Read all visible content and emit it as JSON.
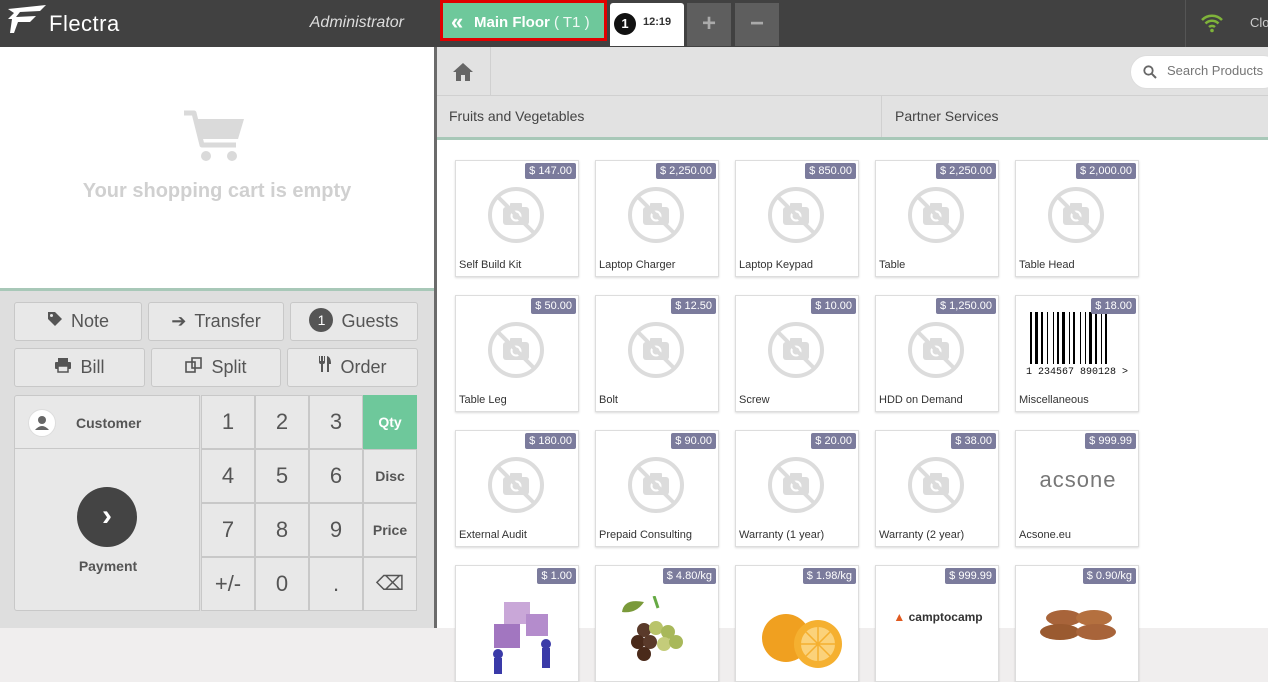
{
  "header": {
    "brand": "Flectra",
    "user": "Administrator",
    "floor_label": "Main Floor",
    "table_label": "( T1 )",
    "order_number": "1",
    "order_time": "12:19",
    "add_order": "+",
    "remove_order": "−",
    "close_label": "Clo"
  },
  "cart": {
    "empty_text": "Your shopping cart is empty"
  },
  "controls": {
    "note": "Note",
    "transfer": "Transfer",
    "guests_count": "1",
    "guests": "Guests",
    "bill": "Bill",
    "split": "Split",
    "order": "Order"
  },
  "pad": {
    "customer": "Customer",
    "payment": "Payment",
    "keys": [
      "1",
      "2",
      "3",
      "4",
      "5",
      "6",
      "7",
      "8",
      "9",
      "+/-",
      "0",
      "."
    ],
    "modes": [
      "Qty",
      "Disc",
      "Price"
    ],
    "backspace": "⌫"
  },
  "search": {
    "placeholder": "Search Products"
  },
  "categories": [
    "Fruits and Vegetables",
    "Partner Services"
  ],
  "products": [
    {
      "name": "Self Build Kit",
      "price": "$ 147.00"
    },
    {
      "name": "Laptop Charger",
      "price": "$ 2,250.00"
    },
    {
      "name": "Laptop Keypad",
      "price": "$ 850.00"
    },
    {
      "name": "Table",
      "price": "$ 2,250.00"
    },
    {
      "name": "Table Head",
      "price": "$ 2,000.00"
    },
    {
      "name": "Table Leg",
      "price": "$ 50.00"
    },
    {
      "name": "Bolt",
      "price": "$ 12.50"
    },
    {
      "name": "Screw",
      "price": "$ 10.00"
    },
    {
      "name": "HDD on Demand",
      "price": "$ 1,250.00"
    },
    {
      "name": "Miscellaneous",
      "price": "$ 18.00"
    },
    {
      "name": "External Audit",
      "price": "$ 180.00"
    },
    {
      "name": "Prepaid Consulting",
      "price": "$ 90.00"
    },
    {
      "name": "Warranty (1 year)",
      "price": "$ 20.00"
    },
    {
      "name": "Warranty (2 year)",
      "price": "$ 38.00"
    },
    {
      "name": "Acsone.eu",
      "price": "$ 999.99"
    },
    {
      "name": "",
      "price": "$ 1.00"
    },
    {
      "name": "",
      "price": "$ 4.80/kg"
    },
    {
      "name": "",
      "price": "$ 1.98/kg"
    },
    {
      "name": "",
      "price": "$ 999.99"
    },
    {
      "name": "",
      "price": "$ 0.90/kg"
    }
  ],
  "barcode_text": "1 234567 890128 >",
  "logo_texts": {
    "acsone": "acsone",
    "camptocamp": "camptocamp"
  },
  "colors": {
    "accent": "#6ec89b",
    "price_badge": "#7b7b9c",
    "topbar": "#414141"
  }
}
